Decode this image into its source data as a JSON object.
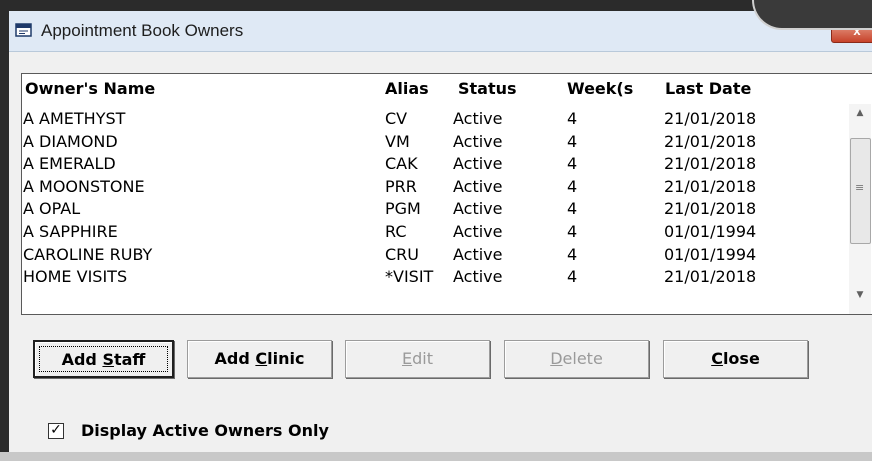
{
  "window": {
    "title": "Appointment Book Owners",
    "close_label": "x"
  },
  "table": {
    "headers": {
      "name": "Owner's Name",
      "alias": "Alias",
      "status": "Status",
      "weeks": "Week(s",
      "last_date": "Last Date"
    },
    "rows": [
      {
        "name": "A AMETHYST",
        "alias": "CV",
        "status": "Active",
        "weeks": "4",
        "last_date": "21/01/2018"
      },
      {
        "name": "A DIAMOND",
        "alias": "VM",
        "status": "Active",
        "weeks": "4",
        "last_date": "21/01/2018"
      },
      {
        "name": "A EMERALD",
        "alias": "CAK",
        "status": "Active",
        "weeks": "4",
        "last_date": "21/01/2018"
      },
      {
        "name": "A MOONSTONE",
        "alias": "PRR",
        "status": "Active",
        "weeks": "4",
        "last_date": "21/01/2018"
      },
      {
        "name": "A OPAL",
        "alias": "PGM",
        "status": "Active",
        "weeks": "4",
        "last_date": "21/01/2018"
      },
      {
        "name": "A SAPPHIRE",
        "alias": "RC",
        "status": "Active",
        "weeks": "4",
        "last_date": "01/01/1994"
      },
      {
        "name": "CAROLINE RUBY",
        "alias": "CRU",
        "status": "Active",
        "weeks": "4",
        "last_date": "01/01/1994"
      },
      {
        "name": "HOME VISITS",
        "alias": "*VISIT",
        "status": "Active",
        "weeks": "4",
        "last_date": "21/01/2018"
      }
    ]
  },
  "buttons": {
    "add_staff": {
      "pre": "Add ",
      "accel": "S",
      "post": "taff"
    },
    "add_clinic": {
      "pre": "Add ",
      "accel": "C",
      "post": "linic"
    },
    "edit": {
      "pre": "",
      "accel": "E",
      "post": "dit"
    },
    "delete": {
      "pre": "",
      "accel": "D",
      "post": "elete"
    },
    "close": {
      "pre": "",
      "accel": "C",
      "post": "lose"
    }
  },
  "checkbox": {
    "label": "Display Active Owners Only",
    "mark": "✓",
    "checked": true
  },
  "colors": {
    "titlebar": "#dfe9f5",
    "close_button": "#c7432b",
    "disabled_text": "#9a9a9a"
  }
}
